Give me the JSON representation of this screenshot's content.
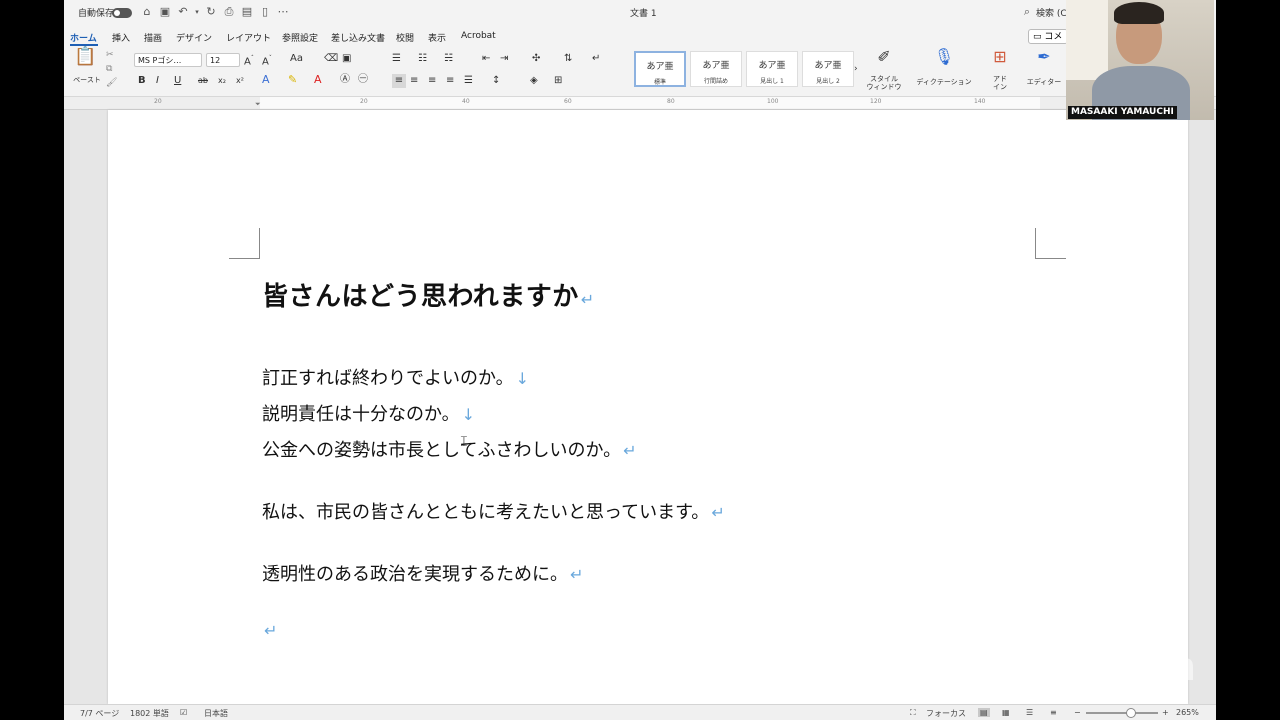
{
  "titlebar": {
    "autosave_label": "自動保存",
    "doc_title": "文書 1",
    "search_label": "検索 (Cm"
  },
  "tabs": [
    "ホーム",
    "挿入",
    "描画",
    "デザイン",
    "レイアウト",
    "参照設定",
    "差し込み文書",
    "校閲",
    "表示",
    "Acrobat"
  ],
  "ribbon": {
    "paste_label": "ペースト",
    "font_name": "MS Pゴシ…",
    "font_size": "12",
    "aa_label": "Aa",
    "bold": "B",
    "italic": "I",
    "underline": "U",
    "strike": "ab",
    "subscript": "x₂",
    "superscript": "x²",
    "styles": [
      {
        "sample": "あア亜",
        "name": "標準"
      },
      {
        "sample": "あア亜",
        "name": "行間詰め"
      },
      {
        "sample": "あア亜",
        "name": "見出し 1"
      },
      {
        "sample": "あア亜",
        "name": "見出し 2"
      }
    ],
    "style_window_label_1": "スタイル",
    "style_window_label_2": "ウィンドウ",
    "dictation_label": "ディクテーション",
    "addin_label_1": "アド",
    "addin_label_2": "イン",
    "editor_label": "エディター",
    "comment_label": "コメ"
  },
  "ruler": [
    "20",
    "20",
    "40",
    "60",
    "80",
    "100",
    "120",
    "140"
  ],
  "document": {
    "heading": "皆さんはどう思われますか",
    "line1": "訂正すれば終わりでよいのか。",
    "line2": "説明責任は十分なのか。",
    "line3": "公金への姿勢は市長としてふさわしいのか。",
    "line4": "私は、市民の皆さんとともに考えたいと思っています。",
    "line5": "透明性のある政治を実現するために。",
    "paragraph_mark": "↵",
    "line_break_mark": "↓"
  },
  "statusbar": {
    "page": "7/7 ページ",
    "words": "1802 単語",
    "language": "日本語",
    "focus": "フォーカス",
    "zoom_level": "265%"
  },
  "webcam": {
    "participant_name": "MASAAKI YAMAUCHI"
  },
  "overlay": {
    "zoom_watermark": "zoom"
  }
}
